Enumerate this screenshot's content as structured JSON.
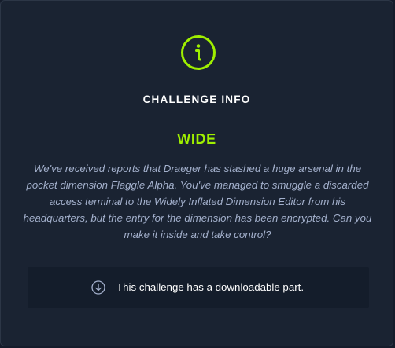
{
  "header": {
    "icon": "info-circle-icon",
    "title": "CHALLENGE INFO"
  },
  "challenge": {
    "name": "WIDE",
    "description": "We've received reports that Draeger has stashed a huge arsenal in the pocket dimension Flaggle Alpha. You've managed to smuggle a discarded access terminal to the Widely Inflated Dimension Editor from his headquarters, but the entry for the dimension has been encrypted. Can you make it inside and take control?"
  },
  "download": {
    "icon": "download-circle-icon",
    "text": "This challenge has a downloadable part."
  },
  "colors": {
    "accent": "#9fef00",
    "panel_background": "#1a2332",
    "text_muted": "#a4b1cd",
    "download_background": "#141d2b"
  }
}
